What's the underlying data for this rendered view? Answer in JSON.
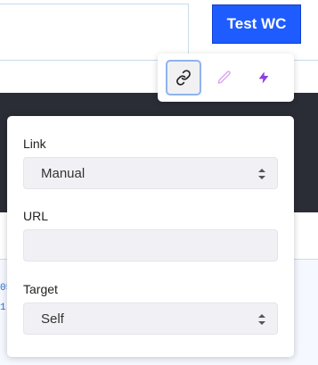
{
  "background": {
    "button_label": "Test WC",
    "edge_text": [
      "05",
      "1!"
    ]
  },
  "toolbar": {
    "buttons": [
      {
        "icon": "link-icon",
        "active": true
      },
      {
        "icon": "pencil-icon",
        "active": false
      },
      {
        "icon": "bolt-icon",
        "active": false
      }
    ]
  },
  "panel": {
    "link_label": "Link",
    "link_value": "Manual",
    "url_label": "URL",
    "url_value": "",
    "target_label": "Target",
    "target_value": "Self"
  },
  "colors": {
    "accent": "#1f5cff",
    "pencil": "#d9a9f0",
    "bolt": "#8a3fe0",
    "dark_band": "#2b2d36"
  }
}
